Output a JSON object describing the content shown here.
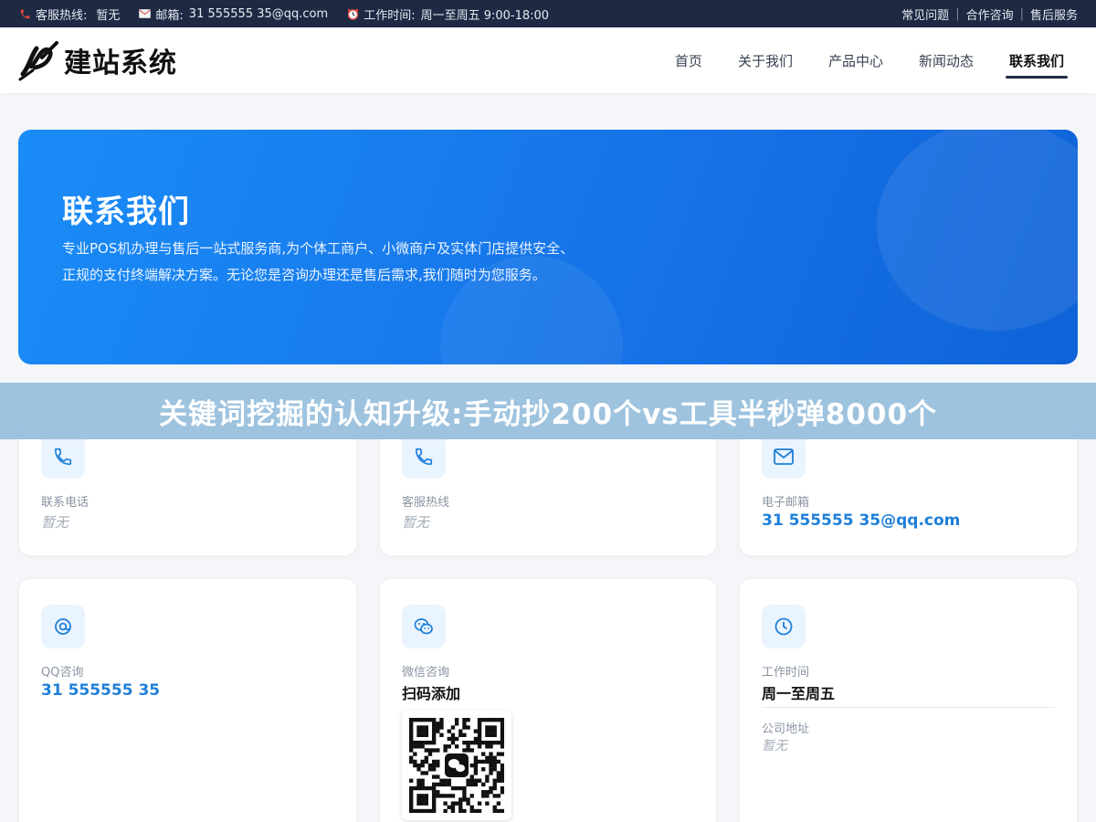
{
  "topbar": {
    "hotline_label": "客服热线:",
    "hotline_value": "暂无",
    "email_label": "邮箱:",
    "email_value": "31 555555 35@qq.com",
    "hours_label": "工作时间:",
    "hours_value": "周一至周五 9:00-18:00",
    "links": [
      "常见问题",
      "合作咨询",
      "售后服务"
    ]
  },
  "header": {
    "logo_text": "建站系统",
    "nav": [
      "首页",
      "关于我们",
      "产品中心",
      "新闻动态",
      "联系我们"
    ],
    "active_nav": "联系我们"
  },
  "hero": {
    "title": "联系我们",
    "description": "专业POS机办理与售后一站式服务商,为个体工商户、小微商户及实体门店提供安全、正规的支付终端解决方案。无论您是咨询办理还是售后需求,我们随时为您服务。"
  },
  "banner": {
    "text": "关键词挖掘的认知升级:手动抄200个vs工具半秒弹8000个"
  },
  "cards": {
    "phone": {
      "label": "联系电话",
      "value": "暂无",
      "icon": "phone-icon"
    },
    "hotline": {
      "label": "客服热线",
      "value": "暂无",
      "icon": "phone-icon"
    },
    "email": {
      "label": "电子邮箱",
      "value": "31 555555 35@qq.com",
      "icon": "mail-icon"
    },
    "qq": {
      "label": "QQ咨询",
      "value": "31 555555 35",
      "icon": "qq-icon"
    },
    "wechat": {
      "label": "微信咨询",
      "value": "扫码添加",
      "icon": "wechat-icon"
    },
    "hours": {
      "label": "工作时间",
      "value": "周一至周五",
      "address_label": "公司地址",
      "address_value": "暂无",
      "icon": "clock-icon"
    }
  },
  "colors": {
    "topbar_bg": "#1e2a44",
    "accent": "#1e7fd9",
    "hero_gradient_start": "#1a8cf7",
    "hero_gradient_end": "#0f62d8"
  }
}
